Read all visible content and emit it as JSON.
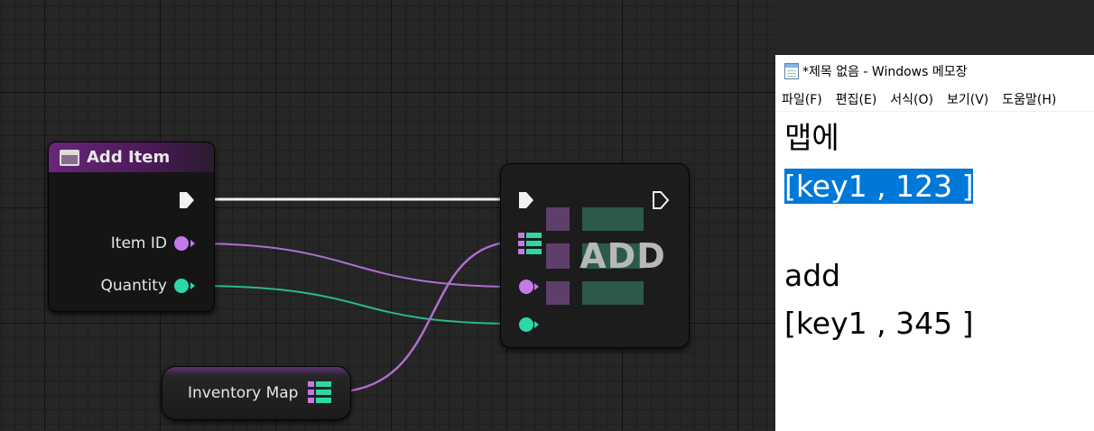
{
  "blueprint": {
    "add_item_node": {
      "title": "Add Item",
      "pins": [
        {
          "label": "Item ID",
          "type": "purple"
        },
        {
          "label": "Quantity",
          "type": "teal"
        }
      ]
    },
    "add_node": {
      "title": "ADD"
    },
    "variable_node": {
      "label": "Inventory Map"
    }
  },
  "notepad": {
    "title": "*제목 없음 - Windows 메모장",
    "menu": [
      "파일(F)",
      "편집(E)",
      "서식(O)",
      "보기(V)",
      "도움말(H)"
    ],
    "lines": [
      {
        "text": "맵에",
        "selected": false
      },
      {
        "text": "[key1 , 123 ]",
        "selected": true
      },
      {
        "text": "",
        "selected": false
      },
      {
        "text": "add",
        "selected": false
      },
      {
        "text": "[key1 , 345 ]",
        "selected": false
      }
    ]
  },
  "colors": {
    "graph_background": "#262626",
    "map_key_pin": "#c47ae6",
    "map_value_pin": "#2ed8a6",
    "function_header": "#6a2679",
    "selection": "#0078d7"
  }
}
